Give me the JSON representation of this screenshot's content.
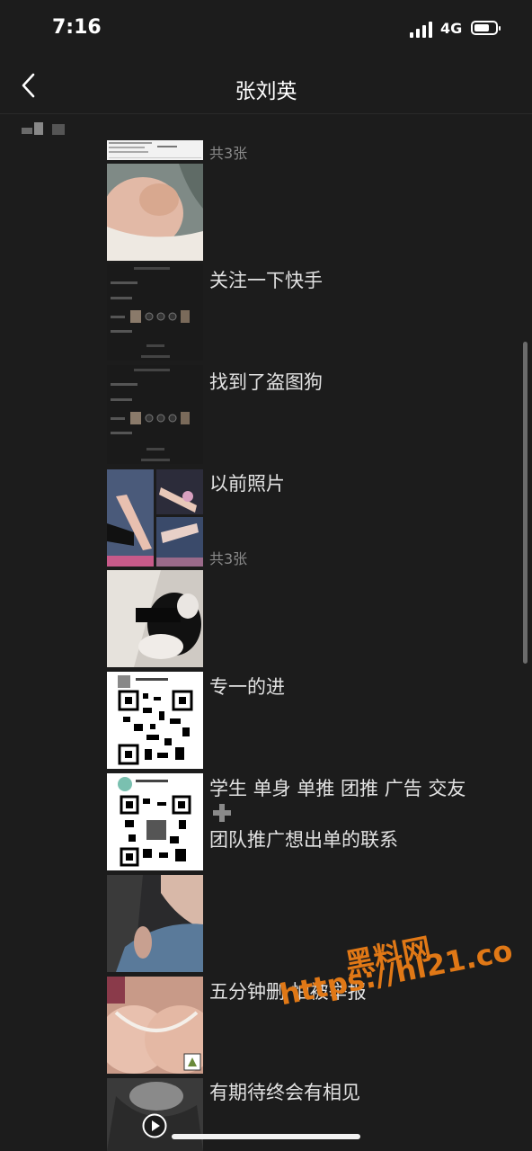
{
  "status_bar": {
    "time": "7:16",
    "network": "4G"
  },
  "nav": {
    "title": "张刘英"
  },
  "posts": {
    "p1_count": "共3张",
    "p2_caption": "关注一下快手",
    "p3_caption": "找到了盗图狗",
    "p4_caption": "以前照片",
    "p4_count": "共3张",
    "p5_caption": "专一的进",
    "p6_caption_line1": "学生 单身 单推 团推 广告 交友",
    "p6_caption_line2": "团队推广想出单的联系",
    "p8_caption": "五分钟删 怕被举报",
    "p9_caption": "有期待终会有相见"
  },
  "watermark": {
    "line1": "黑料网",
    "line2": "https://hl21.co"
  },
  "colors": {
    "background": "#1c1c1c",
    "text": "#e2e2e2",
    "muted": "#8a8a8a",
    "watermark": "#e07816"
  },
  "icons": [
    "back-chevron-icon",
    "signal-icon",
    "battery-icon",
    "play-icon"
  ]
}
